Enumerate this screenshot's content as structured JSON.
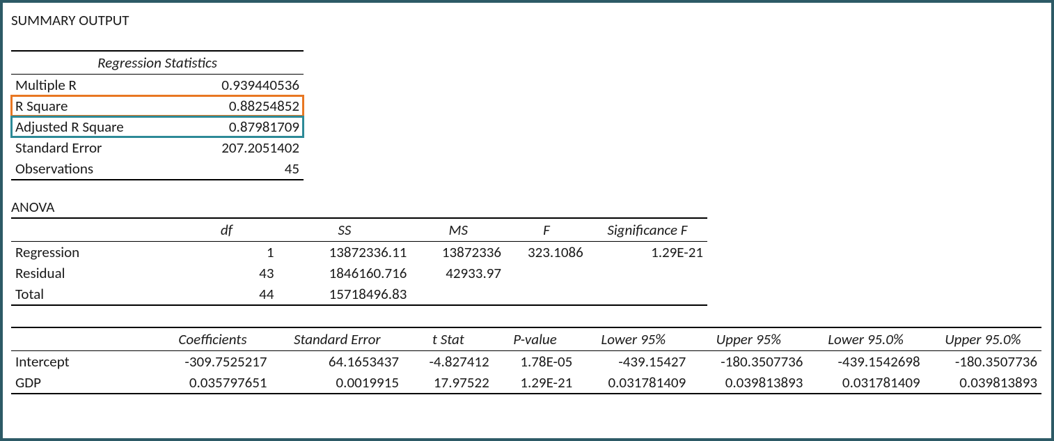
{
  "summary_title": "SUMMARY OUTPUT",
  "regression_stats": {
    "header": "Regression Statistics",
    "rows": [
      {
        "label": "Multiple R",
        "value": "0.939440536"
      },
      {
        "label": "R Square",
        "value": "0.88254852"
      },
      {
        "label": "Adjusted R Square",
        "value": "0.87981709"
      },
      {
        "label": "Standard Error",
        "value": "207.2051402"
      },
      {
        "label": "Observations",
        "value": "45"
      }
    ]
  },
  "anova": {
    "title": "ANOVA",
    "headers": [
      "",
      "df",
      "SS",
      "MS",
      "F",
      "Significance F"
    ],
    "rows": [
      {
        "label": "Regression",
        "df": "1",
        "ss": "13872336.11",
        "ms": "13872336",
        "f": "323.1086",
        "sigf": "1.29E-21"
      },
      {
        "label": "Residual",
        "df": "43",
        "ss": "1846160.716",
        "ms": "42933.97",
        "f": "",
        "sigf": ""
      },
      {
        "label": "Total",
        "df": "44",
        "ss": "15718496.83",
        "ms": "",
        "f": "",
        "sigf": ""
      }
    ]
  },
  "coefficients": {
    "headers": [
      "",
      "Coefficients",
      "Standard Error",
      "t Stat",
      "P-value",
      "Lower 95%",
      "Upper 95%",
      "Lower 95.0%",
      "Upper 95.0%"
    ],
    "rows": [
      {
        "label": "Intercept",
        "coef": "-309.7525217",
        "se": "64.1653437",
        "t": "-4.827412",
        "p": "1.78E-05",
        "l95": "-439.15427",
        "u95": "-180.3507736",
        "l950": "-439.1542698",
        "u950": "-180.3507736"
      },
      {
        "label": "GDP",
        "coef": "0.035797651",
        "se": "0.0019915",
        "t": "17.97522",
        "p": "1.29E-21",
        "l95": "0.031781409",
        "u95": "0.039813893",
        "l950": "0.031781409",
        "u950": "0.039813893"
      }
    ]
  }
}
